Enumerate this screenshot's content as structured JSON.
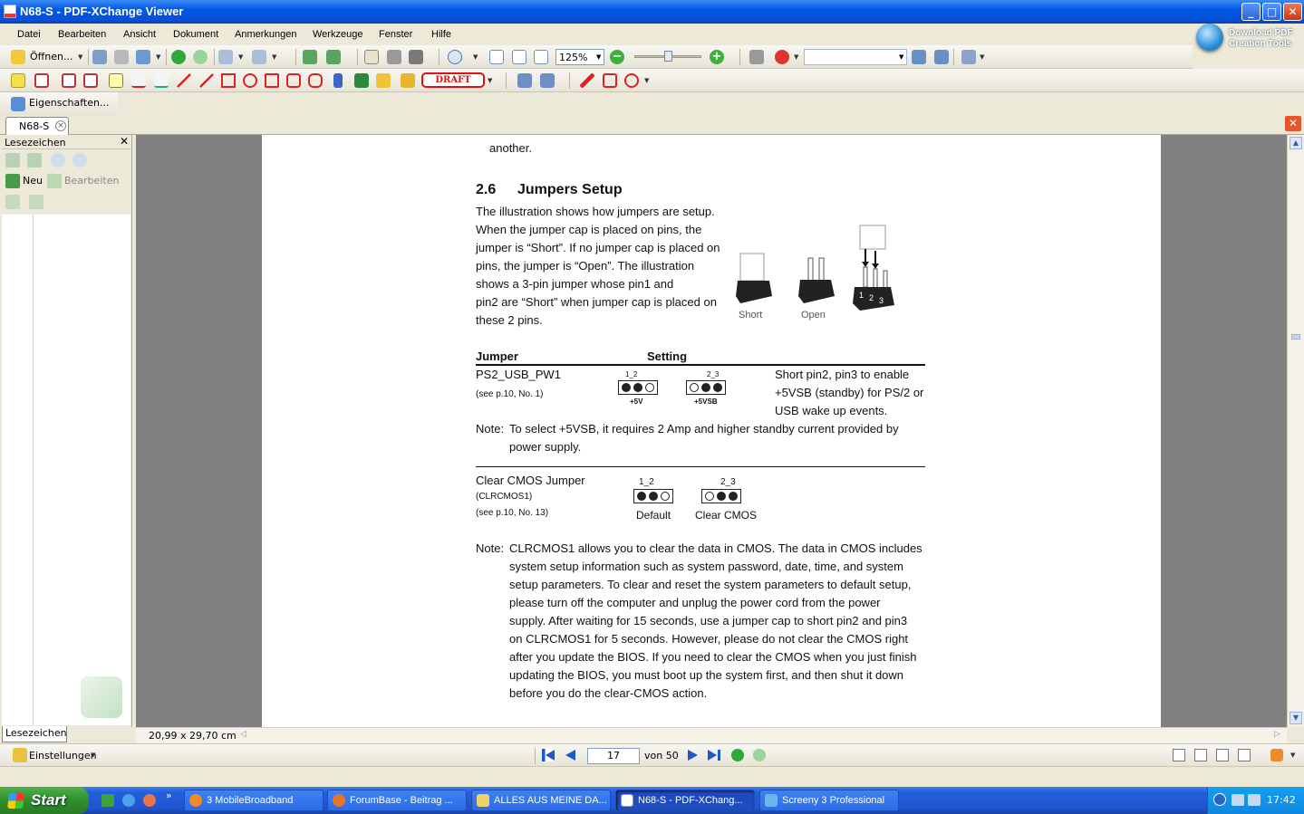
{
  "window": {
    "title": "N68-S - PDF-XChange Viewer",
    "min": "_",
    "max": "□",
    "close": "✕"
  },
  "menu": [
    "Datei",
    "Bearbeiten",
    "Ansicht",
    "Dokument",
    "Anmerkungen",
    "Werkzeuge",
    "Fenster",
    "Hilfe"
  ],
  "toolbar": {
    "open_label": "Öffnen...",
    "zoom_value": "125%",
    "zoom_out": "−",
    "zoom_in": "+",
    "stamp_label": "DRAFT",
    "properties_label": "Eigenschaften..."
  },
  "download_promo": {
    "line1": "Download PDF",
    "line2": "Creation Tools"
  },
  "doc_tab": {
    "label": "N68-S",
    "close": "×"
  },
  "bookmarks": {
    "title": "Lesezeichen",
    "close": "✕",
    "new_label": "Neu",
    "edit_label": "Bearbeiten",
    "tab_label": "Lesezeichen"
  },
  "pdf": {
    "top_text": "another.",
    "heading_num": "2.6",
    "heading": "Jumpers Setup",
    "intro": [
      "The illustration shows how jumpers are setup.",
      "When the jumper cap is placed on pins, the",
      "jumper is “Short”. If no jumper cap is placed on",
      "pins, the jumper is “Open”. The illustration",
      "shows a 3-pin jumper whose pin1 and",
      "pin2 are “Short” when jumper cap is placed on",
      "these 2 pins."
    ],
    "fig_short": "Short",
    "fig_open": "Open",
    "pin_nums": [
      "1",
      "2",
      "3"
    ],
    "table_col1": "Jumper",
    "table_col2": "Setting",
    "j1_name": "PS2_USB_PW1",
    "j1_ref": "(see p.10,  No. 1)",
    "j1_a_top": "1_2",
    "j1_a_bot": "+5V",
    "j1_b_top": "2_3",
    "j1_b_bot": "+5VSB",
    "j1_desc": [
      "Short pin2, pin3 to enable",
      "+5VSB (standby) for PS/2 or",
      "USB wake up events."
    ],
    "note1_label": "Note:",
    "note1": [
      "To select +5VSB, it requires 2 Amp and higher standby current provided by",
      "power supply."
    ],
    "j2_name": "Clear CMOS Jumper",
    "j2_id": "(CLRCMOS1)",
    "j2_ref": "(see p.10,  No. 13)",
    "j2_a_top": "1_2",
    "j2_a_bot": "Default",
    "j2_b_top": "2_3",
    "j2_b_bot": "Clear CMOS",
    "note2_label": "Note:",
    "note2": [
      "CLRCMOS1 allows you to clear the data in CMOS. The data in CMOS includes",
      "system setup information such as system password, date, time, and system",
      "setup parameters. To clear and reset the system parameters to default setup,",
      "please turn off the computer and unplug the power cord from the power",
      "supply. After waiting for 15 seconds, use a jumper cap to short pin2 and pin3",
      "on CLRCMOS1 for 5 seconds. However, please do not clear the CMOS right",
      "after you update the BIOS. If you need to clear the CMOS when you just finish",
      "updating the BIOS, you must boot up the system first, and then shut it down",
      "before you do the clear-CMOS action."
    ]
  },
  "page_size": "20,99 x 29,70 cm",
  "nav": {
    "settings_label": "Einstellungen",
    "page_number": "17",
    "of_total": "von 50"
  },
  "taskbar": {
    "start": "Start",
    "more": "»",
    "tasks": [
      "3 MobileBroadband",
      "ForumBase - Beitrag ...",
      "ALLES AUS MEINE DA...",
      "N68-S - PDF-XChang...",
      "Screeny 3 Professional"
    ],
    "clock": "17:42"
  },
  "colors": {
    "title_blue": "#0058e6",
    "taskbar_blue": "#245edb",
    "start_green": "#2e8f29",
    "viewer_gray": "#808080",
    "draft_red": "#d11"
  }
}
